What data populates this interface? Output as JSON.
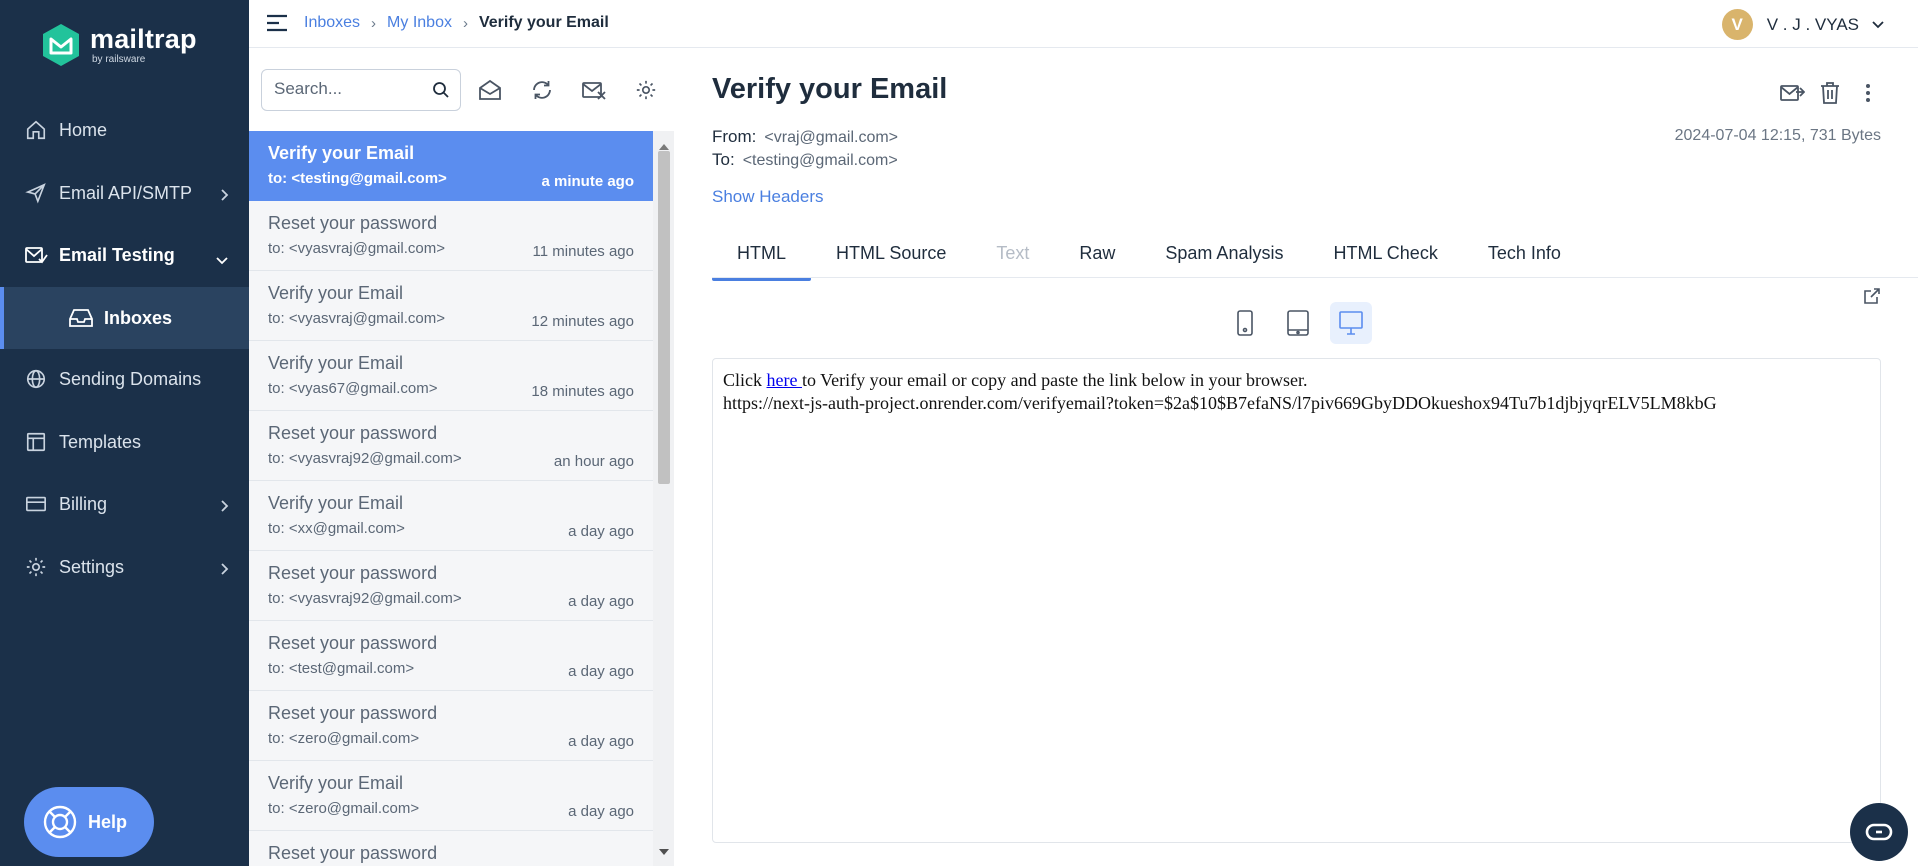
{
  "sidebar": {
    "logo": {
      "name": "mailtrap",
      "sub": "by railsware"
    },
    "items": [
      {
        "label": "Home",
        "icon": "home-icon"
      },
      {
        "label": "Email API/SMTP",
        "icon": "send-icon"
      },
      {
        "label": "Email Testing",
        "icon": "email-testing-icon"
      },
      {
        "label": "Inboxes",
        "icon": "inbox-icon"
      },
      {
        "label": "Sending Domains",
        "icon": "globe-icon"
      },
      {
        "label": "Templates",
        "icon": "template-icon"
      },
      {
        "label": "Billing",
        "icon": "card-icon"
      },
      {
        "label": "Settings",
        "icon": "gear-icon"
      }
    ],
    "help_label": "Help"
  },
  "breadcrumb": [
    "Inboxes",
    "My Inbox",
    "Verify your Email"
  ],
  "user": {
    "initial": "V",
    "name": "V . J . VYAS"
  },
  "search": {
    "placeholder": "Search..."
  },
  "messages": [
    {
      "subject": "Verify your Email",
      "to": "to: <testing@gmail.com>",
      "time": "a minute ago",
      "selected": true
    },
    {
      "subject": "Reset your password",
      "to": "to: <vyasvraj@gmail.com>",
      "time": "11 minutes ago"
    },
    {
      "subject": "Verify your Email",
      "to": "to: <vyasvraj@gmail.com>",
      "time": "12 minutes ago"
    },
    {
      "subject": "Verify your Email",
      "to": "to: <vyas67@gmail.com>",
      "time": "18 minutes ago"
    },
    {
      "subject": "Reset your password",
      "to": "to: <vyasvraj92@gmail.com>",
      "time": "an hour ago"
    },
    {
      "subject": "Verify your Email",
      "to": "to: <xx@gmail.com>",
      "time": "a day ago"
    },
    {
      "subject": "Reset your password",
      "to": "to: <vyasvraj92@gmail.com>",
      "time": "a day ago"
    },
    {
      "subject": "Reset your password",
      "to": "to: <test@gmail.com>",
      "time": "a day ago"
    },
    {
      "subject": "Reset your password",
      "to": "to: <zero@gmail.com>",
      "time": "a day ago"
    },
    {
      "subject": "Verify your Email",
      "to": "to: <zero@gmail.com>",
      "time": "a day ago"
    },
    {
      "subject": "Reset your password",
      "to": "",
      "time": ""
    }
  ],
  "detail": {
    "subject": "Verify your Email",
    "from_label": "From:",
    "from": "<vraj@gmail.com>",
    "to_label": "To:",
    "to": "<testing@gmail.com>",
    "meta": "2024-07-04 12:15, 731 Bytes",
    "show_headers": "Show Headers",
    "tabs": [
      "HTML",
      "HTML Source",
      "Text",
      "Raw",
      "Spam Analysis",
      "HTML Check",
      "Tech Info"
    ],
    "active_tab": "HTML",
    "preview": {
      "before_link": "Click ",
      "link": "here ",
      "after_link": "to Verify your email or copy and paste the link below in your browser.",
      "url": "https://next-js-auth-project.onrender.com/verifyemail?token=$2a$10$B7efaNS/l7piv669GbyDDOkueshox94Tu7b1djbjyqrELV5LM8kbG"
    }
  },
  "colors": {
    "sidebar_bg": "#1b3049",
    "accent": "#5b8def",
    "link": "#4a7fe0",
    "avatar": "#d9b46c"
  }
}
